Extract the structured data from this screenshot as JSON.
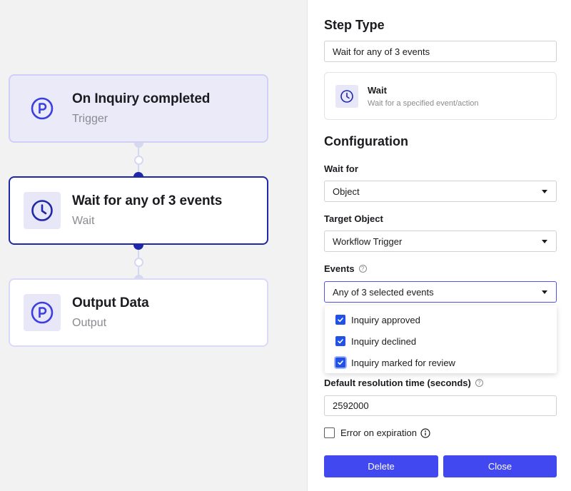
{
  "canvas": {
    "nodes": [
      {
        "title": "On Inquiry completed",
        "subtitle": "Trigger",
        "icon": "persona-p-icon"
      },
      {
        "title": "Wait for any of 3 events",
        "subtitle": "Wait",
        "icon": "clock-icon"
      },
      {
        "title": "Output Data",
        "subtitle": "Output",
        "icon": "persona-p-icon"
      }
    ]
  },
  "panel": {
    "step_type_heading": "Step Type",
    "step_name": "Wait for any of 3 events",
    "type_card": {
      "name": "Wait",
      "description": "Wait for a specified event/action",
      "icon": "clock-icon"
    },
    "configuration_heading": "Configuration",
    "wait_for": {
      "label": "Wait for",
      "value": "Object"
    },
    "target_object": {
      "label": "Target Object",
      "value": "Workflow Trigger"
    },
    "events": {
      "label": "Events",
      "value": "Any of 3 selected events",
      "options": [
        {
          "label": "Inquiry approved",
          "checked": true
        },
        {
          "label": "Inquiry declined",
          "checked": true
        },
        {
          "label": "Inquiry marked for review",
          "checked": true
        }
      ]
    },
    "resolution": {
      "label": "Default resolution time (seconds)",
      "value": "2592000"
    },
    "error_on_expiration": {
      "label": "Error on expiration",
      "checked": false
    },
    "buttons": {
      "delete": "Delete",
      "close": "Close"
    }
  },
  "colors": {
    "accent": "#4148f0",
    "selected_border": "#1f28a8",
    "checkbox": "#2151e6",
    "node_icon": "#3b3ee0"
  }
}
